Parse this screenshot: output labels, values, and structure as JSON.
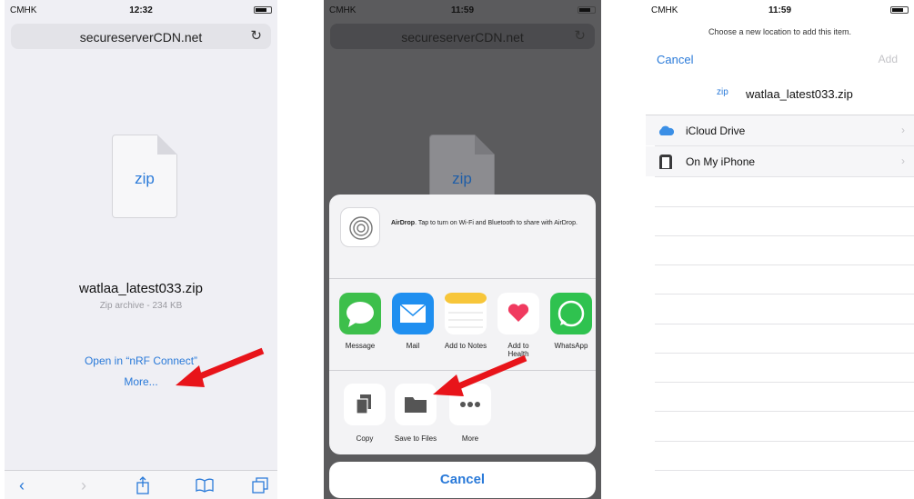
{
  "colors": {
    "accent": "#2a7ad9",
    "arrow": "#e8141a"
  },
  "panel1": {
    "status": {
      "carrier": "CMHK",
      "time": "12:32"
    },
    "url": "secureserverCDN.net",
    "file_icon_label": "zip",
    "file_name": "watlaa_latest033.zip",
    "file_info": "Zip archive - 234 KB",
    "open_in": "Open in “nRF Connect”",
    "more": "More...",
    "toolbar": [
      "back-icon",
      "forward-icon",
      "share-icon",
      "bookmarks-icon",
      "tabs-icon"
    ]
  },
  "panel2": {
    "status": {
      "carrier": "CMHK",
      "time": "11:59"
    },
    "url": "secureserverCDN.net",
    "file_icon_label": "zip",
    "airdrop": {
      "title": "AirDrop",
      "text": ". Tap to turn on Wi-Fi and Bluetooth to share with AirDrop."
    },
    "apps": [
      {
        "label": "Message",
        "icon": "message-icon",
        "color": "#3dbf4b"
      },
      {
        "label": "Mail",
        "icon": "mail-icon",
        "color": "#1f8ff0"
      },
      {
        "label": "Add to Notes",
        "icon": "notes-icon",
        "color": "#ffffff"
      },
      {
        "label": "Add to Health",
        "icon": "health-icon",
        "color": "#ffffff"
      },
      {
        "label": "WhatsApp",
        "icon": "whatsapp-icon",
        "color": "#2fc24f"
      }
    ],
    "actions": [
      {
        "label": "Copy",
        "icon": "copy-icon"
      },
      {
        "label": "Save to Files",
        "icon": "folder-icon"
      },
      {
        "label": "More",
        "icon": "more-icon"
      }
    ],
    "cancel": "Cancel"
  },
  "panel3": {
    "status": {
      "carrier": "CMHK",
      "time": "11:59"
    },
    "prompt": "Choose a new location to add this item.",
    "cancel": "Cancel",
    "add": "Add",
    "file_badge": "zip",
    "file_name": "watlaa_latest033.zip",
    "locations": [
      {
        "label": "iCloud Drive",
        "icon": "icloud-icon"
      },
      {
        "label": "On My iPhone",
        "icon": "iphone-icon"
      }
    ]
  }
}
